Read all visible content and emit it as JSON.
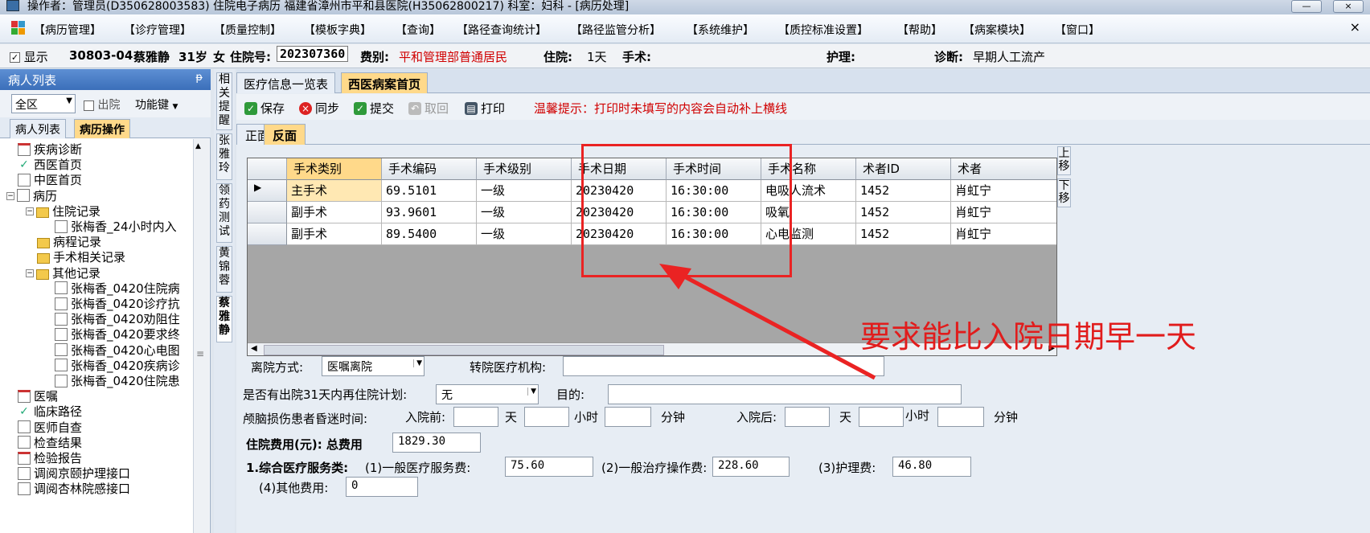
{
  "window": {
    "title": "操作者：管理员(D350628003583) 住院电子病历  福建省漳州市平和县医院(H35062800217)  科室：妇科 - [病历处理]",
    "min_label": "—",
    "close_label": "×"
  },
  "menu": {
    "items": [
      "【病历管理】",
      "【诊疗管理】",
      "【质量控制】",
      "【模板字典】",
      "【查询】",
      "【路径查询统计】",
      "【路径监管分析】",
      "【系统维护】",
      "【质控标准设置】",
      "【帮助】",
      "【病案模块】",
      "【窗口】"
    ],
    "close": "×"
  },
  "patient": {
    "show_label": "显示",
    "bed": "30803-04",
    "name": "蔡雅静",
    "age": "31岁",
    "sex": "女",
    "admission_no_label": "住院号:",
    "admission_no": "202307360",
    "category_label": "费别:",
    "category": "平和管理部普通居民",
    "stay_label": "住院:",
    "stay": "1天",
    "surgery_label": "手术:",
    "surgery": "",
    "nursing_label": "护理:",
    "nursing": "",
    "diagnosis_label": "诊断:",
    "diagnosis": "早期人工流产"
  },
  "leftpanel": {
    "title": "病人列表",
    "pin": "ᵽ",
    "area": "全区",
    "discharged": "出院",
    "function": "功能键",
    "tabs": [
      "病人列表",
      "病历操作"
    ],
    "tree": [
      {
        "label": "疾病诊断",
        "icon": "docr",
        "level": 1
      },
      {
        "label": "西医首页",
        "icon": "ok",
        "level": 1
      },
      {
        "label": "中医首页",
        "icon": "doc",
        "level": 1
      },
      {
        "label": "病历",
        "icon": "doc",
        "level": 1,
        "expander": "−"
      },
      {
        "label": "住院记录",
        "icon": "fold",
        "level": 2,
        "expander": "−"
      },
      {
        "label": "张梅香_24小时内入",
        "icon": "doc",
        "level": 3
      },
      {
        "label": "病程记录",
        "icon": "fold",
        "level": 2
      },
      {
        "label": "手术相关记录",
        "icon": "fold",
        "level": 2
      },
      {
        "label": "其他记录",
        "icon": "fold",
        "level": 2,
        "expander": "−"
      },
      {
        "label": "张梅香_0420住院病",
        "icon": "doc",
        "level": 3
      },
      {
        "label": "张梅香_0420诊疗抗",
        "icon": "doc",
        "level": 3
      },
      {
        "label": "张梅香_0420劝阻住",
        "icon": "doc",
        "level": 3
      },
      {
        "label": "张梅香_0420要求终",
        "icon": "doc",
        "level": 3
      },
      {
        "label": "张梅香_0420心电图",
        "icon": "doc",
        "level": 3
      },
      {
        "label": "张梅香_0420疾病诊",
        "icon": "doc",
        "level": 3
      },
      {
        "label": "张梅香_0420住院患",
        "icon": "doc",
        "level": 3
      },
      {
        "label": "医嘱",
        "icon": "docr",
        "level": 1
      },
      {
        "label": "临床路径",
        "icon": "ok",
        "level": 1
      },
      {
        "label": "医师自查",
        "icon": "doc",
        "level": 1
      },
      {
        "label": "检查结果",
        "icon": "doc",
        "level": 1
      },
      {
        "label": "检验报告",
        "icon": "docr",
        "level": 1
      },
      {
        "label": "调阅京颐护理接口",
        "icon": "doc",
        "level": 1
      },
      {
        "label": "调阅杏林院感接口",
        "icon": "doc",
        "level": 1
      }
    ]
  },
  "vtabs": [
    "相关提醒",
    "张雅玲",
    "领药测试",
    "黄锦蓉",
    "蔡雅静"
  ],
  "doctabs": [
    "医疗信息一览表",
    "西医病案首页"
  ],
  "toolbar": {
    "save": "保存",
    "sync": "同步",
    "submit": "提交",
    "revoke": "取回",
    "print": "打印",
    "tip": "温馨提示：打印时未填写的内容会自动补上横线"
  },
  "subtabs": [
    "正面",
    "反面"
  ],
  "surgery_table": {
    "headers": [
      "手术类别",
      "手术编码",
      "手术级别",
      "手术日期",
      "手术时间",
      "手术名称",
      "术者ID",
      "术者"
    ],
    "rows": [
      [
        "主手术",
        "69.5101",
        "一级",
        "20230420",
        "16:30:00",
        "电吸人流术",
        "1452",
        "肖虹宁"
      ],
      [
        "副手术",
        "93.9601",
        "一级",
        "20230420",
        "16:30:00",
        "吸氧",
        "1452",
        "肖虹宁"
      ],
      [
        "副手术",
        "89.5400",
        "一级",
        "20230420",
        "16:30:00",
        "心电监测",
        "1452",
        "肖虹宁"
      ]
    ],
    "up": "上移",
    "down": "下移"
  },
  "form": {
    "discharge_method_label": "离院方式:",
    "discharge_method": "医嘱离院",
    "transfer_org_label": "转院医疗机构:",
    "transfer_org": "",
    "readmit_label": "是否有出院31天内再住院计划:",
    "readmit": "无",
    "purpose_label": "目的:",
    "purpose": "",
    "coma_label": "颅脑损伤患者昏迷时间:",
    "before_label": "入院前:",
    "after_label": "入院后:",
    "day": "天",
    "hour": "小时",
    "minute": "分钟",
    "cost_label": "住院费用(元): 总费用",
    "total_cost": "1829.30",
    "service_label": "1.综合医疗服务类:",
    "general_service_label": "(1)一般医疗服务费:",
    "general_service": "75.60",
    "general_treatment_label": "(2)一般治疗操作费:",
    "general_treatment": "228.60",
    "nursing_fee_label": "(3)护理费:",
    "nursing_fee": "46.80",
    "other_fee_label": "(4)其他费用:",
    "other_fee": "0"
  },
  "annotation": {
    "text": "要求能比入院日期早一天",
    "color": "#e11c1c"
  }
}
